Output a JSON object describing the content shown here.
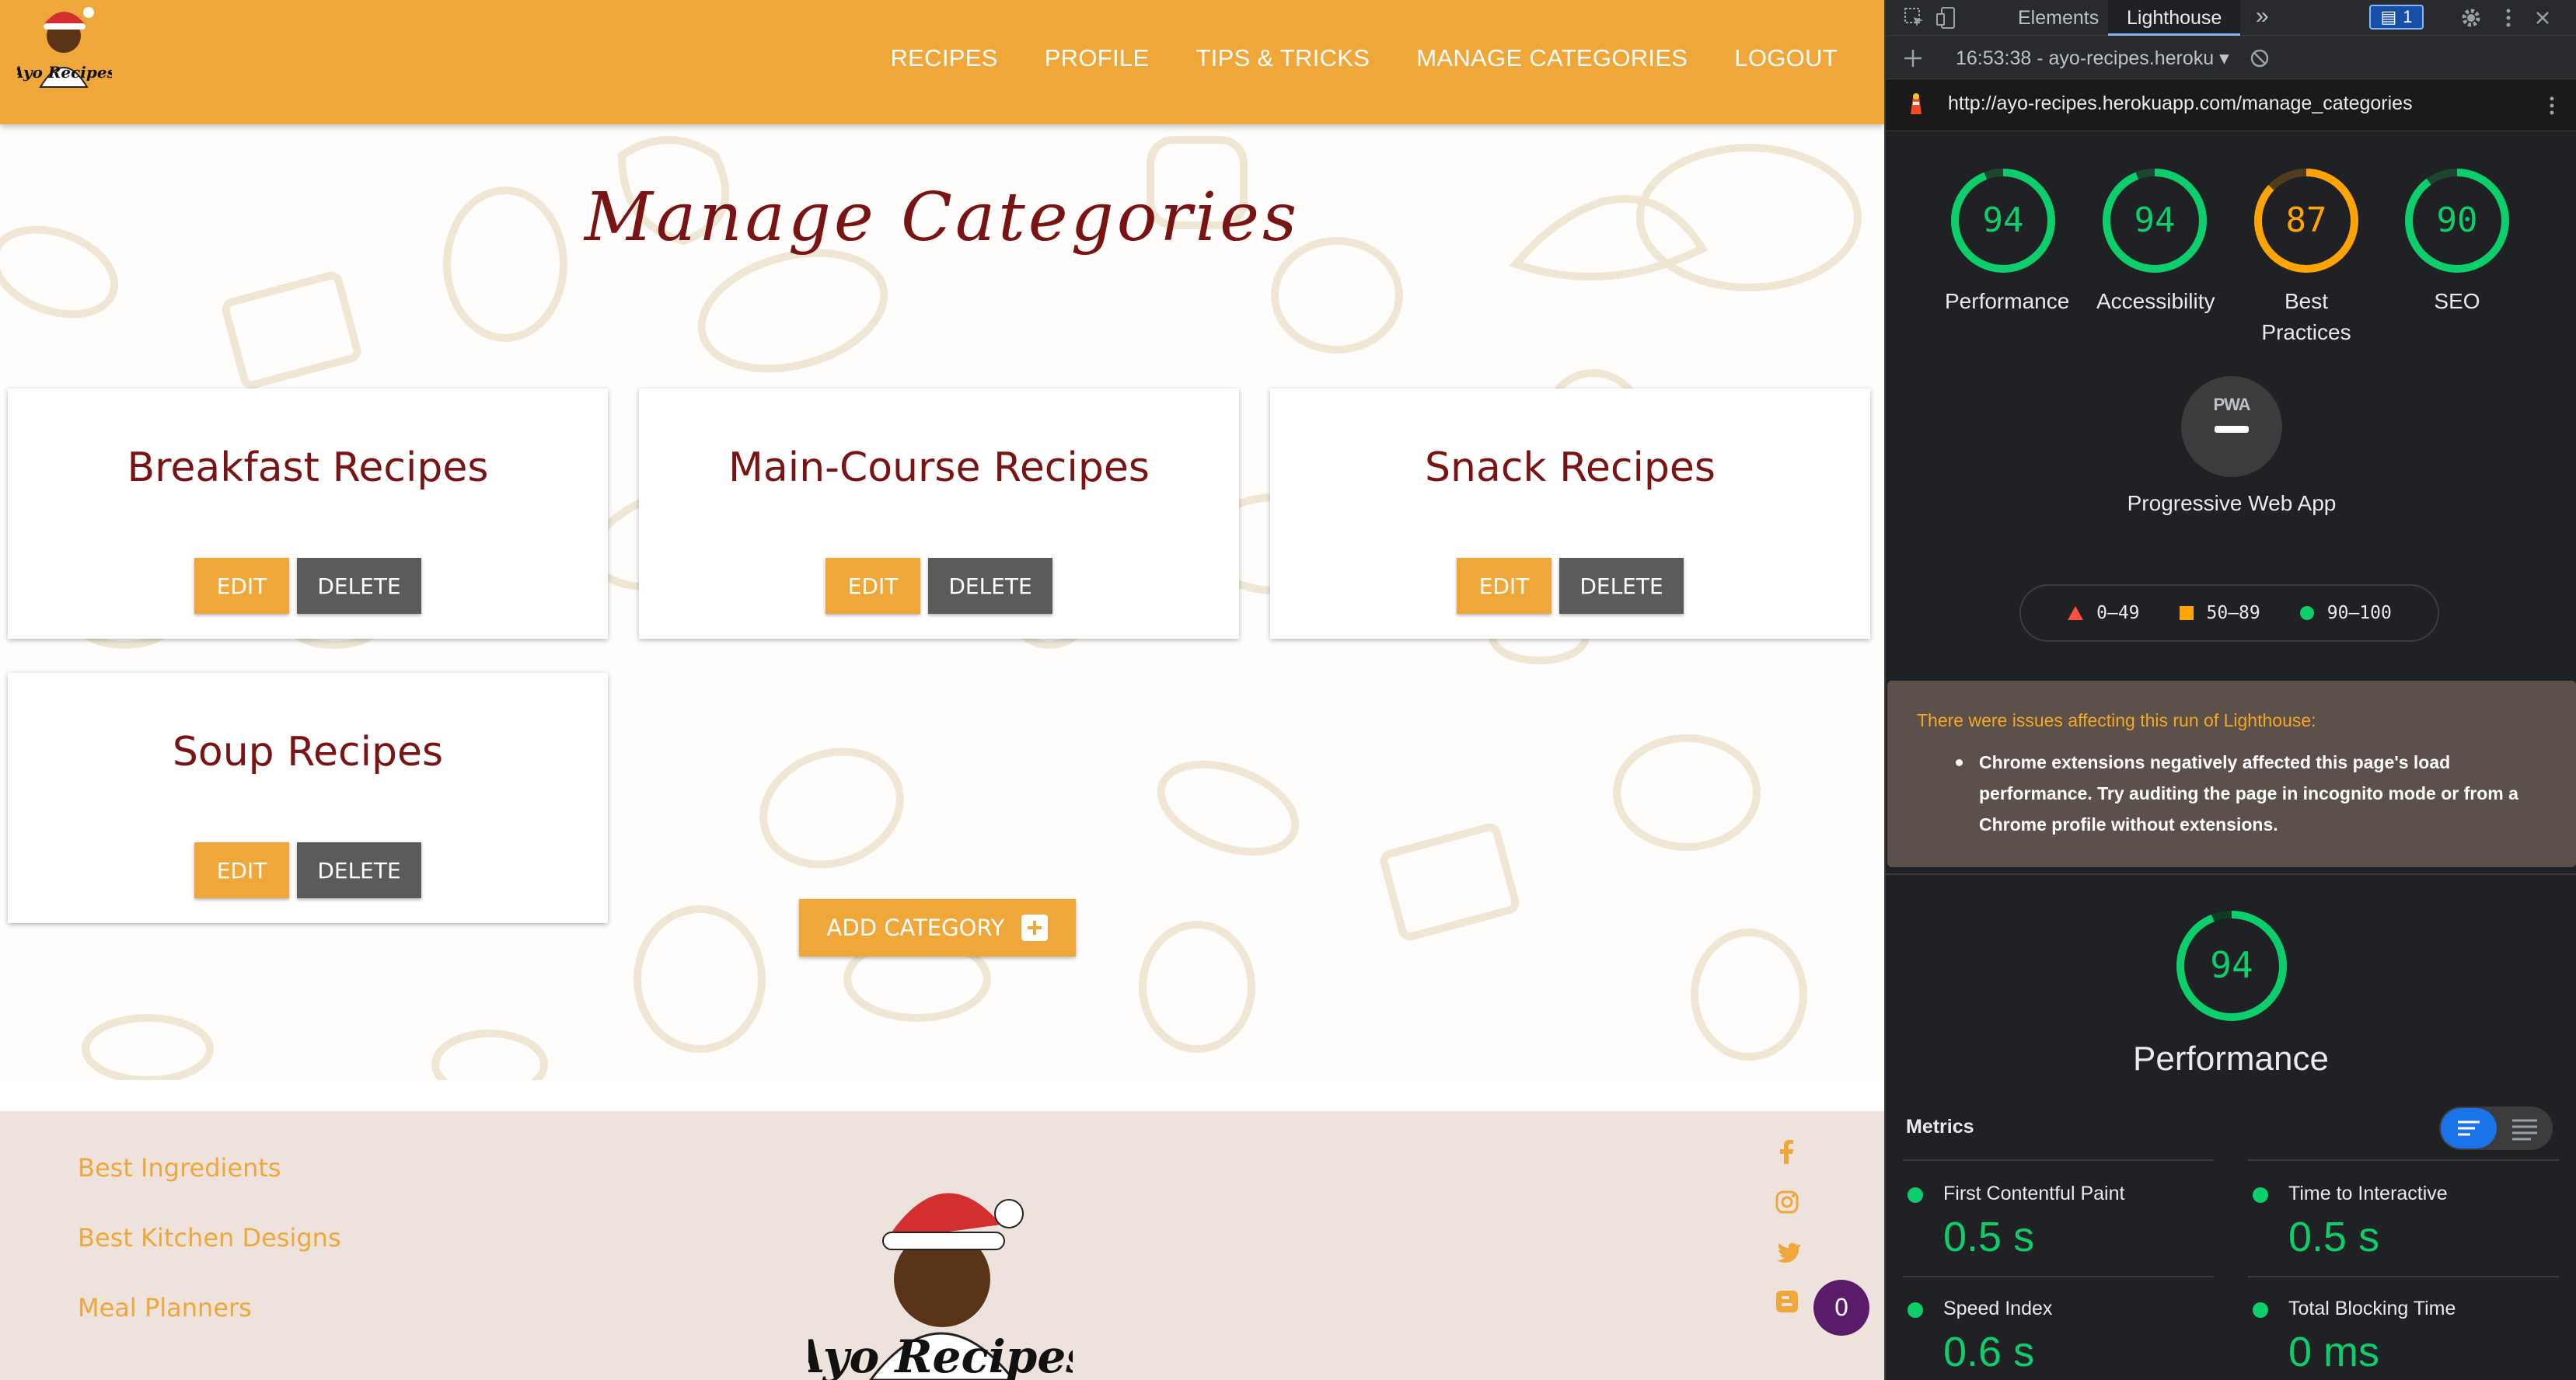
{
  "site": {
    "nav": {
      "links": [
        "RECIPES",
        "PROFILE",
        "TIPS & TRICKS",
        "MANAGE CATEGORIES",
        "LOGOUT"
      ]
    },
    "logo_text": "Ayo Recipes",
    "page_title": "Manage Categories",
    "categories": [
      {
        "name": "Breakfast Recipes",
        "edit_label": "EDIT",
        "delete_label": "DELETE"
      },
      {
        "name": "Main-Course Recipes",
        "edit_label": "EDIT",
        "delete_label": "DELETE"
      },
      {
        "name": "Snack Recipes",
        "edit_label": "EDIT",
        "delete_label": "DELETE"
      },
      {
        "name": "Soup Recipes",
        "edit_label": "EDIT",
        "delete_label": "DELETE"
      }
    ],
    "add_category_label": "ADD CATEGORY",
    "footer_links": [
      "Best Ingredients",
      "Best Kitchen Designs",
      "Meal Planners"
    ],
    "social_icons": [
      "facebook-icon",
      "instagram-icon",
      "twitter-icon",
      "blogger-icon"
    ],
    "cart_count": "0",
    "colors": {
      "brand": "#f0a73a",
      "title": "#7a1313",
      "delete": "#5b5b5b",
      "footer_bg": "#ede3dc"
    }
  },
  "devtools": {
    "tabs": [
      "Elements",
      "Lighthouse"
    ],
    "active_tab": "Lighthouse",
    "issues_count": "1",
    "report_select": "16:53:38 - ayo-recipes.heroku",
    "url": "http://ayo-recipes.herokuapp.com/manage_categories",
    "scores": [
      {
        "label": "Performance",
        "value": 94,
        "color": "#0cce6b"
      },
      {
        "label": "Accessibility",
        "value": 94,
        "color": "#0cce6b"
      },
      {
        "label": "Best Practices",
        "value": 87,
        "color": "#ffa400"
      },
      {
        "label": "SEO",
        "value": 90,
        "color": "#0cce6b"
      }
    ],
    "pwa": {
      "badge": "PWA",
      "label": "Progressive Web App"
    },
    "legend": [
      "0–49",
      "50–89",
      "90–100"
    ],
    "warning": {
      "title": "There were issues affecting this run of Lighthouse:",
      "item": "Chrome extensions negatively affected this page's load performance. Try auditing the page in incognito mode or from a Chrome profile without extensions."
    },
    "performance_score": 94,
    "performance_title": "Performance",
    "metrics_label": "Metrics",
    "metrics": [
      {
        "name": "First Contentful Paint",
        "value": "0.5 s"
      },
      {
        "name": "Time to Interactive",
        "value": "0.5 s"
      },
      {
        "name": "Speed Index",
        "value": "0.6 s"
      },
      {
        "name": "Total Blocking Time",
        "value": "0 ms"
      }
    ]
  }
}
